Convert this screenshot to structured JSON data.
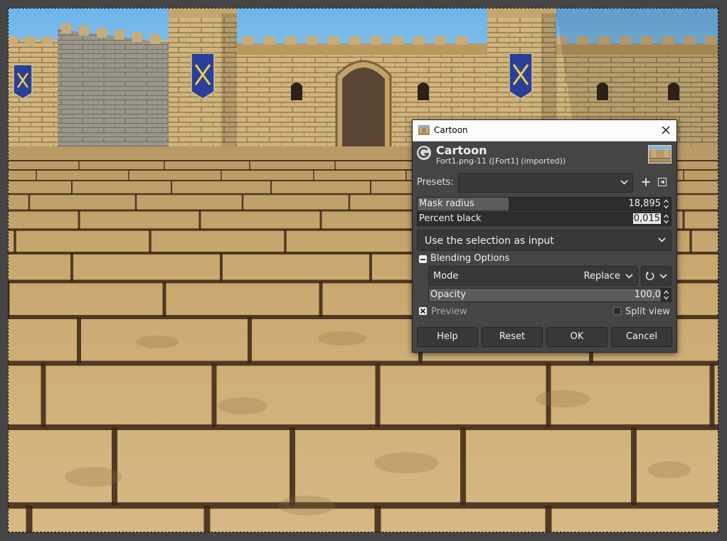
{
  "dialog": {
    "window_title": "Cartoon",
    "op_name": "Cartoon",
    "op_subtitle": "Fort1.png-11 ([Fort1] (imported))",
    "presets_label": "Presets:",
    "presets_value": "",
    "mask_radius": {
      "label": "Mask radius",
      "value": "18,895",
      "fill_fraction": 0.36
    },
    "percent_black": {
      "label": "Percent black",
      "value": "0,015"
    },
    "input_option": "Use the selection as input",
    "blending": {
      "label": "Blending Options",
      "mode_label": "Mode",
      "mode_value": "Replace",
      "opacity_label": "Opacity",
      "opacity_value": "100,0"
    },
    "preview_label": "Preview",
    "preview_checked": true,
    "split_view_label": "Split view",
    "split_view_checked": false,
    "buttons": {
      "help": "Help",
      "reset": "Reset",
      "ok": "OK",
      "cancel": "Cancel"
    }
  },
  "icons": {
    "window": "thumbnail-icon",
    "close": "close-icon",
    "logo": "gimp-logo-icon",
    "add": "add-preset-icon",
    "menu": "preset-menu-icon",
    "composite": "composite-mode-icon"
  },
  "colors": {
    "dialog_bg": "#454545",
    "titlebar_bg": "#fbfbfb",
    "widget_bg": "#383838",
    "spin_fill": "#5c5c5c",
    "banner_blue": "#2a3f9a"
  }
}
